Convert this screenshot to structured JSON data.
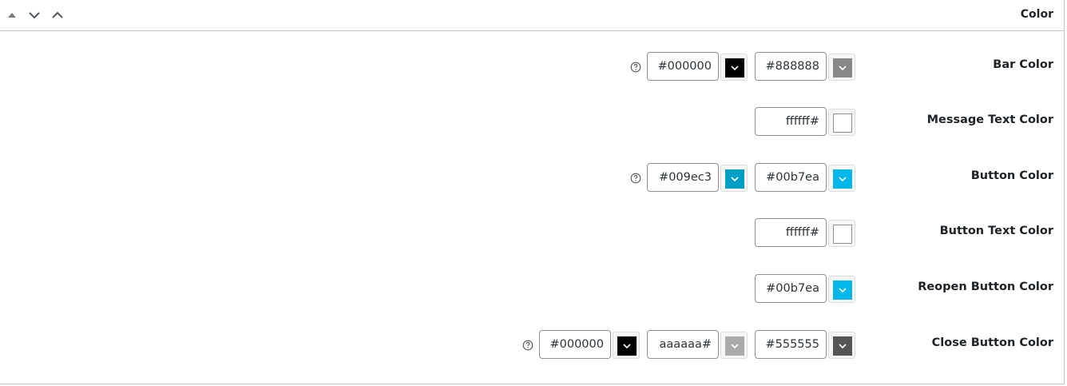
{
  "panel": {
    "title": "Color",
    "controls": [
      "move-up",
      "collapse",
      "expand"
    ]
  },
  "rows": [
    {
      "label": "Bar Color",
      "has_help": true,
      "fields": [
        {
          "value": "#000000",
          "swatch": "#000000",
          "caret": "#ffffff"
        },
        {
          "value": "#888888",
          "swatch": "#888888",
          "caret": "#ffffff"
        }
      ]
    },
    {
      "label": "Message Text Color",
      "has_help": false,
      "fields": [
        {
          "value": "ffffff#",
          "swatch": "#ffffff",
          "caret": ""
        }
      ]
    },
    {
      "label": "Button Color",
      "has_help": true,
      "fields": [
        {
          "value": "#009ec3",
          "swatch": "#009ec3",
          "caret": "#ffffff"
        },
        {
          "value": "#00b7ea",
          "swatch": "#00b7ea",
          "caret": "#ffffff"
        }
      ]
    },
    {
      "label": "Button Text Color",
      "has_help": false,
      "fields": [
        {
          "value": "ffffff#",
          "swatch": "#ffffff",
          "caret": ""
        }
      ]
    },
    {
      "label": "Reopen Button Color",
      "has_help": false,
      "fields": [
        {
          "value": "#00b7ea",
          "swatch": "#00b7ea",
          "caret": "#ffffff"
        }
      ]
    },
    {
      "label": "Close Button Color",
      "has_help": true,
      "fields": [
        {
          "value": "#000000",
          "swatch": "#000000",
          "caret": "#ffffff"
        },
        {
          "value": "aaaaaa#",
          "swatch": "#aaaaaa",
          "caret": "#ffffff"
        },
        {
          "value": "#555555",
          "swatch": "#555555",
          "caret": "#ffffff"
        }
      ]
    }
  ]
}
